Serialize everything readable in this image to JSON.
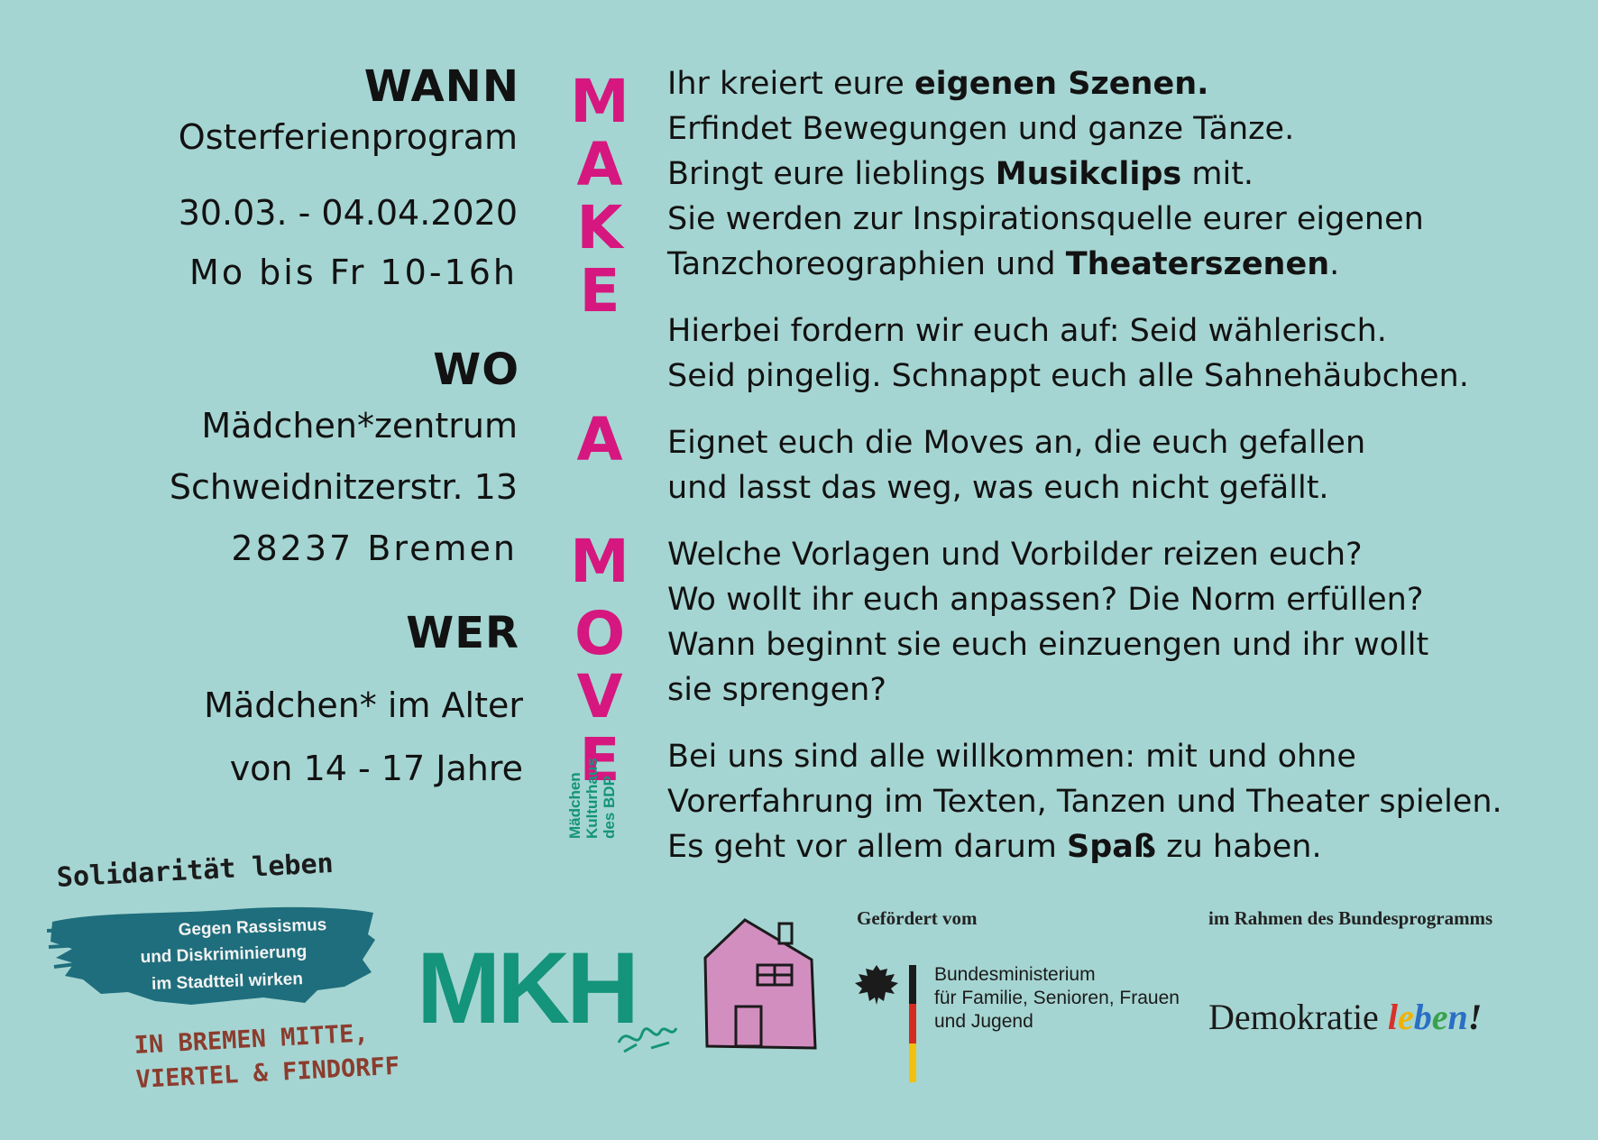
{
  "left": {
    "wann": {
      "heading": "WANN",
      "lines": [
        "Osterferienprogram",
        "30.03. - 04.04.2020",
        "Mo bis Fr 10-16h"
      ]
    },
    "wo": {
      "heading": "WO",
      "lines": [
        "Mädchen*zentrum",
        "Schweidnitzerstr. 13",
        "28237 Bremen"
      ]
    },
    "wer": {
      "heading": "WER",
      "lines": [
        "Mädchen* im Alter",
        "von 14 - 17 Jahre"
      ]
    }
  },
  "vertical_title": [
    "M",
    "A",
    "K",
    "E",
    "A",
    "M",
    "O",
    "V",
    "E"
  ],
  "body": {
    "p1": {
      "l1_a": "Ihr kreiert eure ",
      "l1_b": "eigenen Szenen.",
      "l2": "Erfindet Bewegungen und ganze Tänze.",
      "l3_a": "Bringt eure lieblings ",
      "l3_b": "Musikclips",
      "l3_c": " mit.",
      "l4": "Sie werden zur Inspirationsquelle eurer eigenen",
      "l5_a": "Tanzchoreographien und ",
      "l5_b": "Theaterszenen",
      "l5_c": "."
    },
    "p2": {
      "l1": "Hierbei fordern wir euch auf: Seid wählerisch.",
      "l2": "Seid pingelig. Schnappt euch alle Sahnehäubchen."
    },
    "p3": {
      "l1": "Eignet euch die Moves an, die euch gefallen",
      "l2": "und lasst das weg, was euch nicht gefällt."
    },
    "p4": {
      "l1": "Welche Vorlagen und Vorbilder reizen euch?",
      "l2": "Wo wollt ihr euch anpassen? Die Norm erfüllen?",
      "l3": "Wann beginnt sie euch einzuengen und ihr wollt",
      "l4": "sie sprengen?"
    },
    "p5": {
      "l1": "Bei uns sind alle willkommen: mit und ohne",
      "l2": "Vorerfahrung im Texten, Tanzen und Theater spielen.",
      "l3_a": "Es geht vor allem darum ",
      "l3_b": "Spaß",
      "l3_c": " zu haben."
    }
  },
  "solidaritaet": {
    "title": "Solidarität leben",
    "sub": [
      "Gegen Rassismus",
      "und Diskriminierung",
      "im Stadtteil wirken"
    ],
    "location": [
      "IN BREMEN MITTE,",
      "VIERTEL & FINDORFF"
    ]
  },
  "mkh": {
    "word": "MKH",
    "side": [
      "Mädchen",
      "Kulturhaus",
      "des BDP"
    ]
  },
  "gefoerdert": "Gefördert vom",
  "ministry": [
    "Bundesministerium",
    "für Familie, Senioren, Frauen",
    "und Jugend"
  ],
  "rahmen": "im Rahmen des Bundesprogramms",
  "demokratie": {
    "word": "Demokratie",
    "leben": [
      "l",
      "e",
      "b",
      "e",
      "n",
      "!"
    ]
  },
  "colors": {
    "background": "#a5d5d2",
    "accent_magenta": "#d6177f",
    "mkh_green": "#14947a",
    "brush_teal": "#1f6e7d",
    "house_pink": "#d38ec0"
  },
  "icons": [
    "house-icon",
    "federal-eagle-icon",
    "flag-stripe-icon"
  ]
}
